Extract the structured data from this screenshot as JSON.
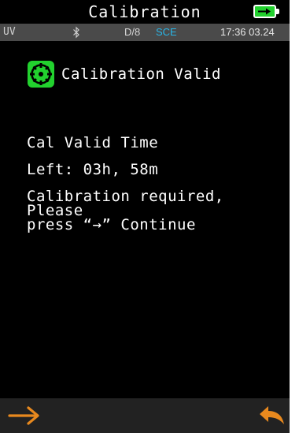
{
  "title": "Calibration",
  "status_bar": {
    "light_source": "UV",
    "geometry": "D/8",
    "mode": "SCE",
    "time": "17:36 03.24"
  },
  "calibration": {
    "status": "Calibration Valid",
    "valid_time_label": "Cal Valid Time",
    "time_left": "Left: 03h, 58m",
    "message_line1": "Calibration required,",
    "message_line2": "Please",
    "message_line3": "press “→” Continue"
  },
  "icons": {
    "battery": "battery-charging-icon",
    "bluetooth": "bluetooth-icon",
    "status": "calibration-valid-icon",
    "next": "arrow-right-icon",
    "back": "return-arrow-icon"
  },
  "colors": {
    "accent_green": "#22d12e",
    "next_arrow": "#e8891e",
    "back_arrow": "#e8891e",
    "mode_blue": "#29b6e8",
    "status_bar": "#4a4a4a"
  }
}
